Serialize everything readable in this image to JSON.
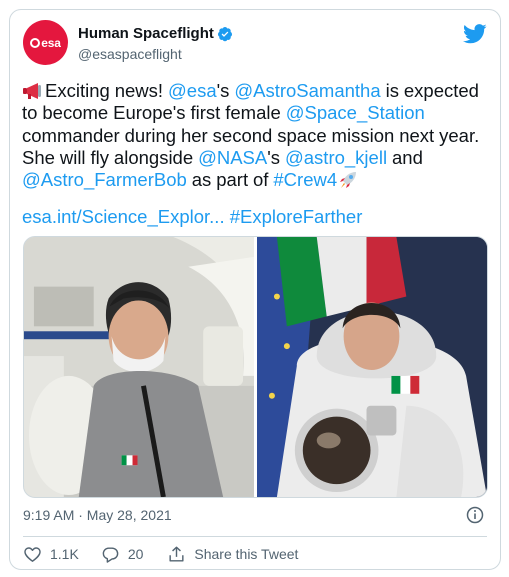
{
  "account": {
    "avatar_text": "esa",
    "display_name": "Human Spaceflight",
    "handle": "@esaspaceflight"
  },
  "tweet": {
    "t1": "Exciting news! ",
    "m1": "@esa",
    "t2": "'s ",
    "m2": "@AstroSamantha",
    "t3": " is expected to become Europe's first female ",
    "m3": "@Space_Station",
    "t4": " commander during her second space mission next year. She will fly alongside ",
    "m4": "@NASA",
    "t5": "'s ",
    "m5": "@astro_kjell",
    "t6": " and ",
    "m6": "@Astro_FarmerBob",
    "t7": " as part of ",
    "m7": "#Crew4",
    "link": "esa.int/Science_Explor...",
    "hashtag": "#ExploreFarther"
  },
  "meta": {
    "timestamp": "9:19 AM · May 28, 2021"
  },
  "actions": {
    "likes": "1.1K",
    "replies": "20",
    "share_label": "Share this Tweet"
  },
  "colors": {
    "link": "#1d9bf0",
    "like_red": "#e4173e",
    "secondary_text": "#536471"
  }
}
